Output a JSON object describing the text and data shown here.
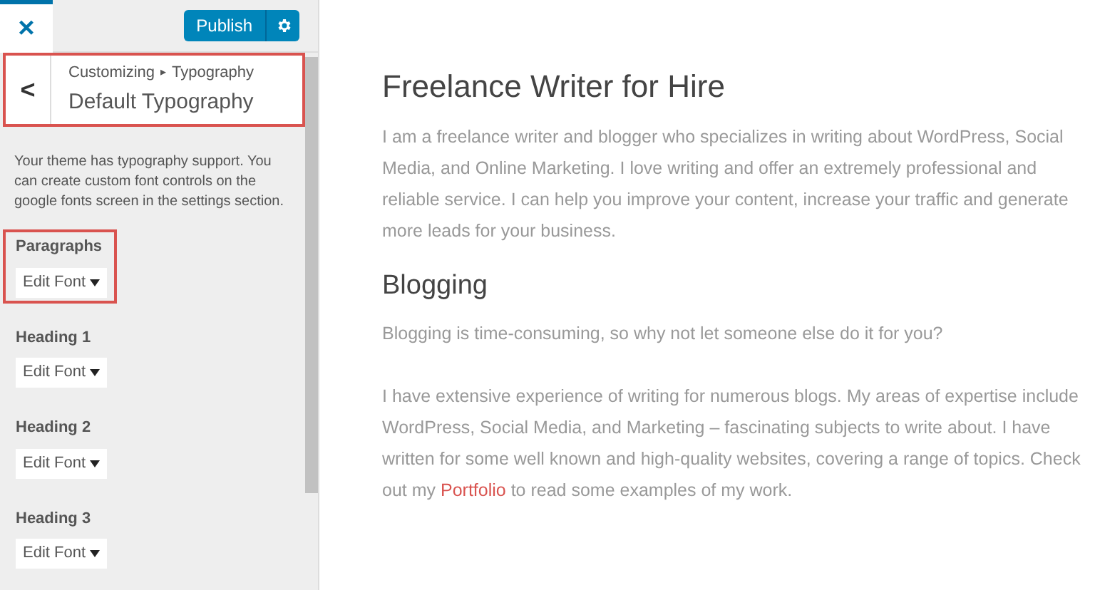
{
  "sidebar": {
    "close": "×",
    "publish": "Publish",
    "header": {
      "highlighted": true,
      "back": "<",
      "breadcrumb_root": "Customizing",
      "breadcrumb_sep": "▸",
      "breadcrumb_section": "Typography",
      "title": "Default Typography"
    },
    "description": "Your theme has typography support. You can create custom font controls on the google fonts screen in the settings section.",
    "font_controls": [
      {
        "label": "Paragraphs",
        "button": "Edit Font",
        "highlighted": true
      },
      {
        "label": "Heading 1",
        "button": "Edit Font",
        "highlighted": false
      },
      {
        "label": "Heading 2",
        "button": "Edit Font",
        "highlighted": false
      },
      {
        "label": "Heading 3",
        "button": "Edit Font",
        "highlighted": false
      }
    ]
  },
  "preview": {
    "title": "Freelance Writer for Hire",
    "intro": "I am a freelance writer and blogger who specializes in writing about WordPress, Social Media, and Online Marketing. I love writing and offer an extremely professional and reliable service. I can help you improve your content, increase your traffic and generate more leads for your business.",
    "section_title": "Blogging",
    "section_intro": "Blogging is time-consuming, so why not let someone else do it for you?",
    "section_body": {
      "text_before": "I have extensive experience of writing for numerous blogs. My areas of expertise include WordPress, Social Media, and Marketing – fascinating subjects to write about. I have written for some well known and high-quality websites, covering a range of topics. Check out my ",
      "link": "Portfolio",
      "text_after": " to read some examples of my work."
    }
  }
}
